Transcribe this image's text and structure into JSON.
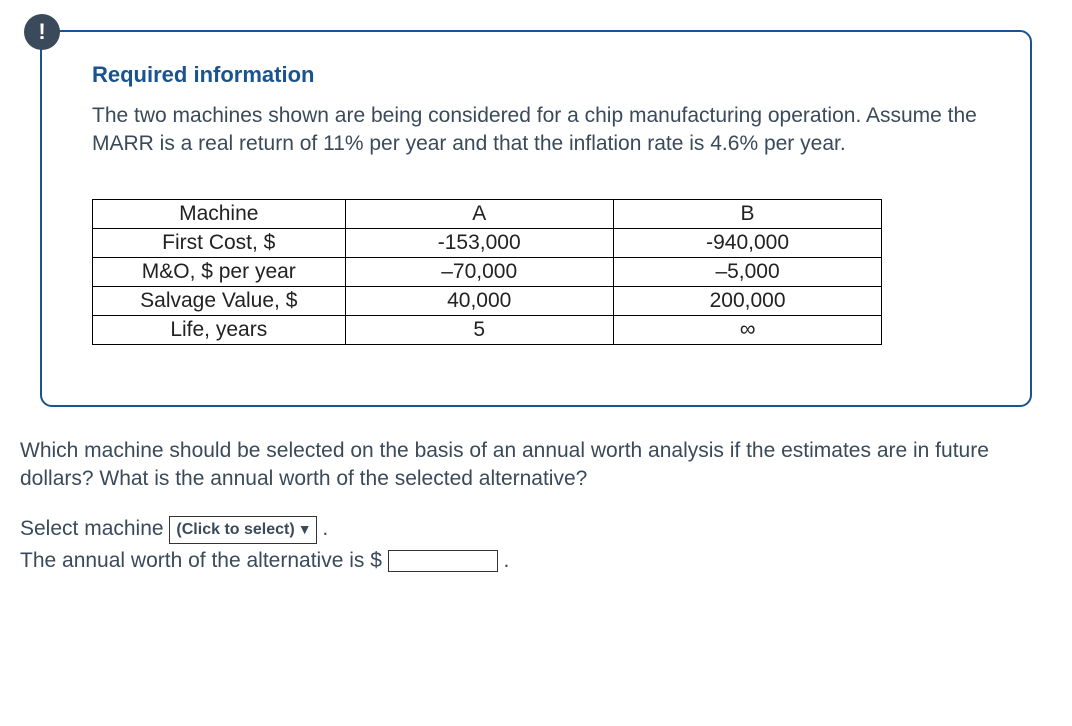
{
  "alert_symbol": "!",
  "heading": "Required information",
  "info_paragraph": "The two machines shown are being considered for a chip manufacturing operation. Assume the MARR is a real return of 11% per year and that the inflation rate is 4.6% per year.",
  "table": {
    "rows": [
      [
        "Machine",
        "A",
        "B"
      ],
      [
        "First Cost, $",
        "-153,000",
        "-940,000"
      ],
      [
        "M&O, $ per year",
        "–70,000",
        "–5,000"
      ],
      [
        "Salvage Value, $",
        "40,000",
        "200,000"
      ],
      [
        "Life, years",
        "5",
        "∞"
      ]
    ]
  },
  "question": "Which machine should be selected on the basis of an annual worth analysis if the estimates are in future dollars? What is the annual worth of the selected alternative?",
  "answer": {
    "line1_prefix": "Select machine ",
    "dropdown_label": "(Click to select)",
    "line1_suffix": " .",
    "line2_prefix": "The annual worth of the alternative is $ ",
    "line2_suffix": " ."
  }
}
